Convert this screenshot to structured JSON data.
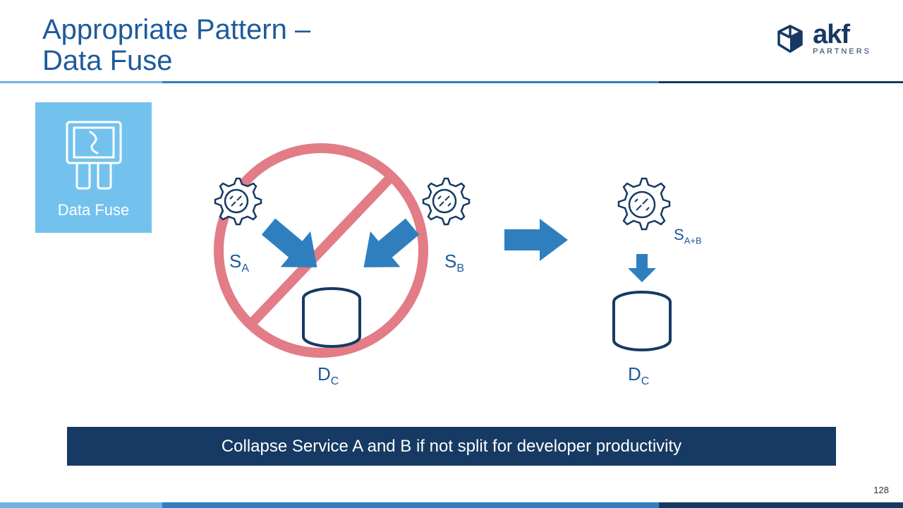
{
  "title_line1": "Appropriate Pattern –",
  "title_line2": "Data Fuse",
  "logo": {
    "brand": "akf",
    "sub": "PARTNERS"
  },
  "pattern_card": {
    "label": "Data Fuse"
  },
  "labels": {
    "sa": "S",
    "sa_sub": "A",
    "sb": "S",
    "sb_sub": "B",
    "sab": "S",
    "sab_sub": "A+B",
    "dc1": "D",
    "dc1_sub": "C",
    "dc2": "D",
    "dc2_sub": "C"
  },
  "caption": "Collapse Service A and B if not split for developer productivity",
  "page_number": "128",
  "colors": {
    "primary": "#1d5a9b",
    "dark": "#163a63",
    "light": "#73c2ee",
    "arrow": "#2f7fbf",
    "prohibit": "#e27c87"
  }
}
